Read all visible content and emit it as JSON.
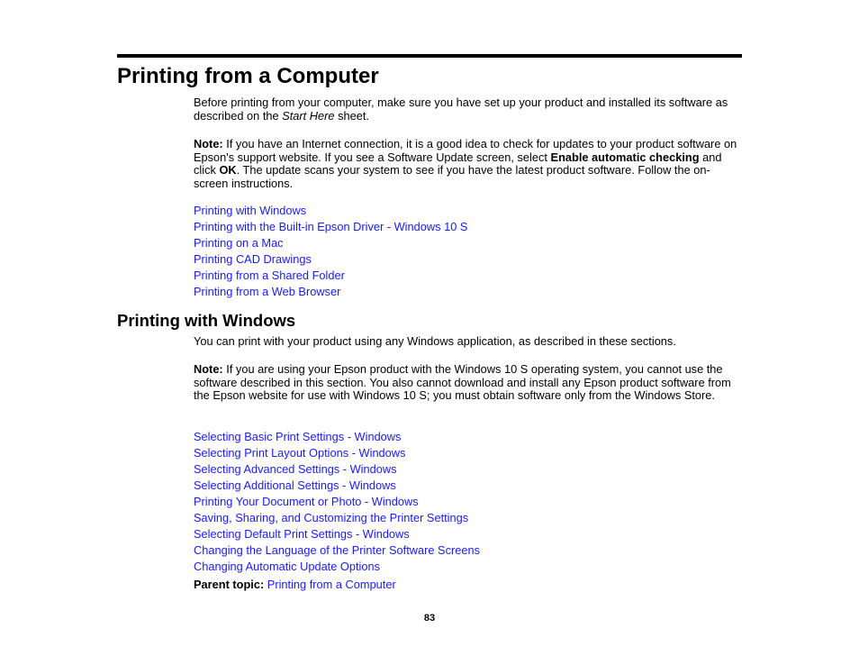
{
  "page_title": "Printing from a Computer",
  "intro": {
    "text_before": "Before printing from your computer, make sure you have set up your product and installed its software as described on the ",
    "italic": "Start Here",
    "text_after": " sheet."
  },
  "note1": {
    "label": "Note:",
    "t1": " If you have an Internet connection, it is a good idea to check for updates to your product software on Epson's support website. If you see a Software Update screen, select ",
    "b1": "Enable automatic checking",
    "t2": " and click ",
    "b2": "OK",
    "t3": ". The update scans your system to see if you have the latest product software. Follow the on-screen instructions."
  },
  "top_links": [
    "Printing with Windows",
    "Printing with the Built-in Epson Driver - Windows 10 S",
    "Printing on a Mac",
    "Printing CAD Drawings",
    "Printing from a Shared Folder",
    "Printing from a Web Browser"
  ],
  "section_title": "Printing with Windows",
  "section_intro": "You can print with your product using any Windows application, as described in these sections.",
  "note2": {
    "label": "Note:",
    "text": " If you are using your Epson product with the Windows 10 S operating system, you cannot use the software described in this section. You also cannot download and install any Epson product software from the Epson website for use with Windows 10 S; you must obtain software only from the Windows Store."
  },
  "section_links": [
    "Selecting Basic Print Settings - Windows",
    "Selecting Print Layout Options - Windows",
    "Selecting Advanced Settings - Windows",
    "Selecting Additional Settings - Windows",
    "Printing Your Document or Photo - Windows",
    "Saving, Sharing, and Customizing the Printer Settings",
    "Selecting Default Print Settings - Windows",
    "Changing the Language of the Printer Software Screens",
    "Changing Automatic Update Options"
  ],
  "parent_topic": {
    "label": "Parent topic:",
    "link": "Printing from a Computer"
  },
  "page_number": "83",
  "colors": {
    "link": "#1a1aff",
    "text": "#000000"
  }
}
